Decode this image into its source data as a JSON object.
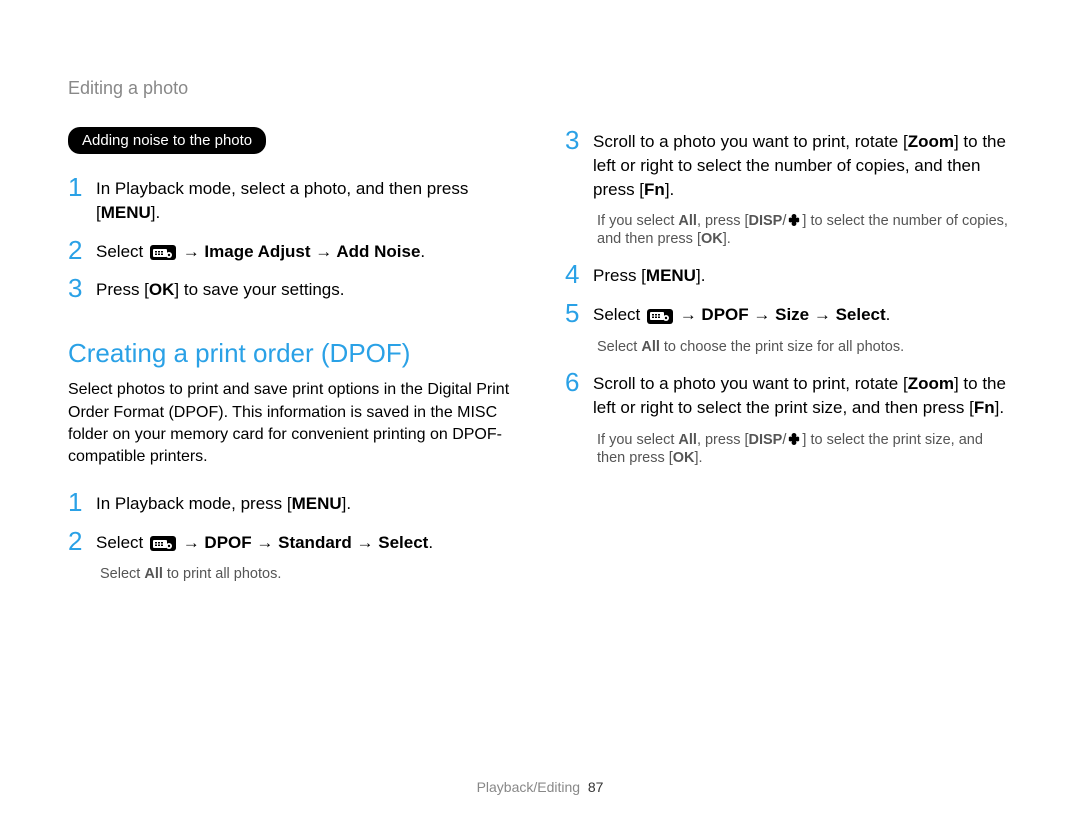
{
  "breadcrumb": "Editing a photo",
  "left": {
    "pill": "Adding noise to the photo",
    "steps": [
      {
        "num": "1",
        "pre": "In Playback mode, select a photo, and then press [",
        "key": "MENU",
        "post": "]."
      },
      {
        "num": "2",
        "pre": "Select ",
        "iconTrail": " → Image Adjust → Add Noise",
        "post": "."
      },
      {
        "num": "3",
        "pre": "Press [",
        "key": "OK",
        "post": "] to save your settings."
      }
    ],
    "sectionTitle": "Creating a print order (DPOF)",
    "lead": "Select photos to print and save print options in the Digital Print Order Format (DPOF). This information is saved in the MISC folder on your memory card for convenient printing on DPOF-compatible printers.",
    "steps2": [
      {
        "num": "1",
        "pre": "In Playback mode, press [",
        "key": "MENU",
        "post": "]."
      },
      {
        "num": "2",
        "pre": "Select ",
        "iconTrail": " → DPOF → Standard → Select",
        "post": "."
      }
    ],
    "note2": {
      "text1": "Select ",
      "bold": "All",
      "text2": " to print all photos."
    }
  },
  "right": {
    "step3": {
      "num": "3",
      "pre": "Scroll to a photo you want to print, rotate [",
      "zoom": "Zoom",
      "mid": "] to the left or right to select the number of copies, and then press [",
      "fn": "Fn",
      "post": "]."
    },
    "note3": {
      "t1": "If you select ",
      "all": "All",
      "t2": ", press [",
      "disp": "DISP",
      "slash": "/",
      "t3": "] to select the number of copies, and then press [",
      "ok": "OK",
      "t4": "]."
    },
    "step4": {
      "num": "4",
      "pre": "Press [",
      "key": "MENU",
      "post": "]."
    },
    "step5": {
      "num": "5",
      "pre": "Select ",
      "iconTrail": " → DPOF → Size → Select",
      "post": "."
    },
    "note5": {
      "t1": "Select ",
      "all": "All",
      "t2": " to choose the print size for all photos."
    },
    "step6": {
      "num": "6",
      "pre": "Scroll to a photo you want to print, rotate [",
      "zoom": "Zoom",
      "mid": "] to the left or right to select the print size, and then press [",
      "fn": "Fn",
      "post": "]."
    },
    "note6": {
      "t1": "If you select ",
      "all": "All",
      "t2": ", press [",
      "disp": "DISP",
      "slash": "/",
      "t3": "] to select the print size, and then press [",
      "ok": "OK",
      "t4": "]."
    }
  },
  "footer": {
    "section": "Playback/Editing",
    "page": "87"
  }
}
